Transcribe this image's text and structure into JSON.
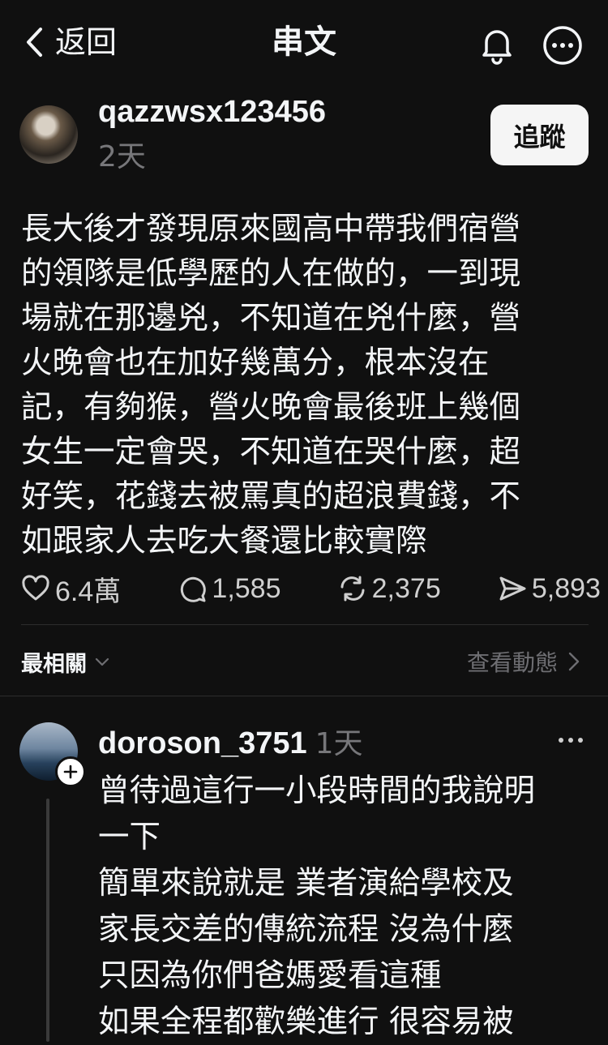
{
  "nav": {
    "back_label": "返回",
    "title": "串文"
  },
  "post": {
    "username": "qazzwsx123456",
    "time": "2天",
    "follow_label": "追蹤",
    "body": "長大後才發現原來國高中帶我們宿營\n的領隊是低學歷的人在做的，一到現\n場就在那邊兇，不知道在兇什麼，營\n火晚會也在加好幾萬分，根本沒在\n記，有夠猴，營火晚會最後班上幾個\n女生一定會哭，不知道在哭什麼，超\n好笑，花錢去被罵真的超浪費錢，不\n如跟家人去吃大餐還比較實際",
    "stats": {
      "likes": "6.4萬",
      "comments": "1,585",
      "reposts": "2,375",
      "shares": "5,893"
    }
  },
  "sort": {
    "label": "最相關",
    "activity_label": "查看動態"
  },
  "reply": {
    "username": "doroson_3751",
    "time": "1天",
    "body": "曾待過這行一小段時間的我說明\n一下\n簡單來說就是 業者演給學校及\n家長交差的傳統流程 沒為什麼\n只因為你們爸媽愛看這種\n如果全程都歡樂進行 很容易被"
  },
  "icons": {
    "back": "chevron-left-icon",
    "bell": "bell-icon",
    "more": "more-circle-icon",
    "like": "heart-icon",
    "comment": "comment-icon",
    "repost": "repost-icon",
    "share": "send-icon"
  },
  "colors": {
    "background": "#101010",
    "text": "#f3f5f7",
    "muted": "#77777a",
    "follow_bg": "#f5f5f5"
  }
}
